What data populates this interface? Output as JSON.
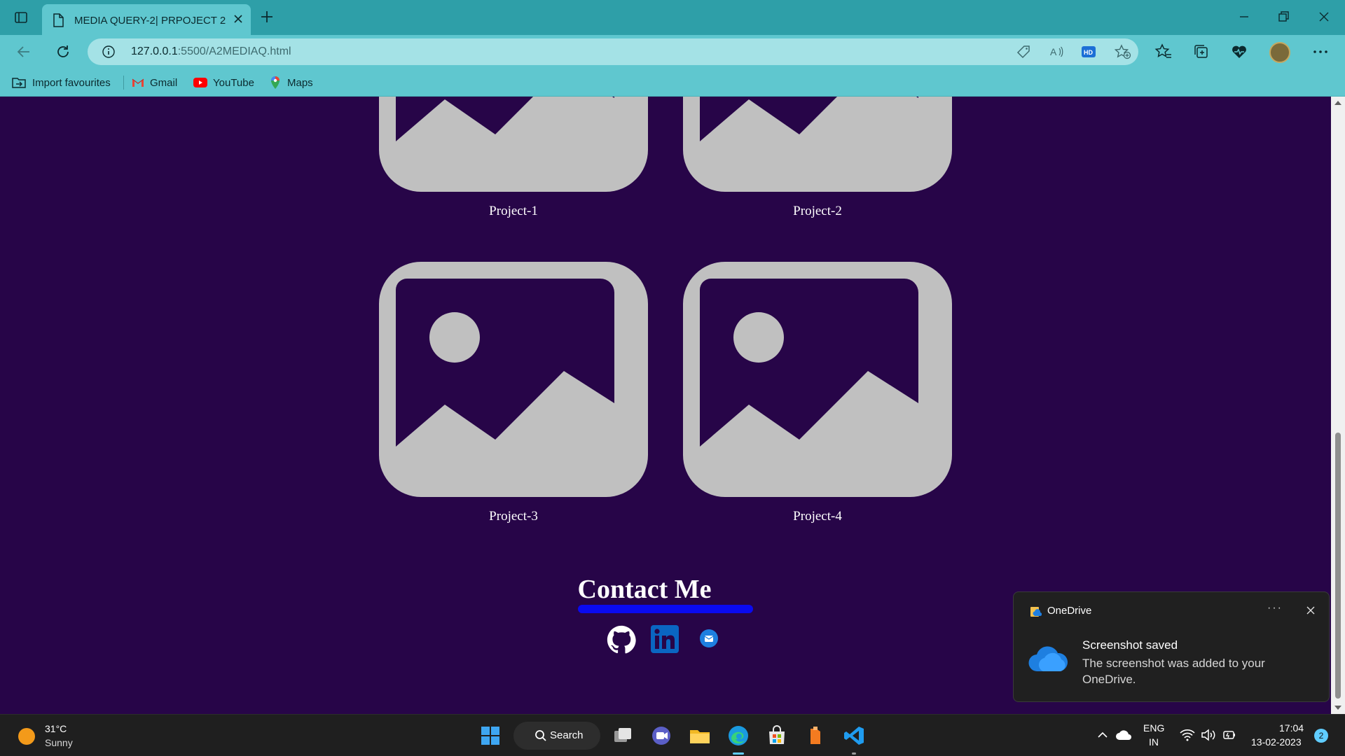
{
  "browser": {
    "tab_title": "MEDIA QUERY-2| PRPOJECT 2",
    "url_host": "127.0.0.1",
    "url_rest": ":5500/A2MEDIAQ.html",
    "favourites": [
      {
        "label": "Import favourites",
        "icon": "import-icon"
      },
      {
        "label": "Gmail",
        "icon": "gmail-icon"
      },
      {
        "label": "YouTube",
        "icon": "youtube-icon"
      },
      {
        "label": "Maps",
        "icon": "maps-icon"
      }
    ]
  },
  "page": {
    "background": "#270548",
    "placeholder_color": "#c0c0c0",
    "projects": [
      {
        "caption": "Project-1"
      },
      {
        "caption": "Project-2"
      },
      {
        "caption": "Project-3"
      },
      {
        "caption": "Project-4"
      }
    ],
    "contact": {
      "title": "Contact Me",
      "underline_color": "#0a0af0",
      "links": [
        {
          "icon": "github-icon"
        },
        {
          "icon": "linkedin-icon"
        },
        {
          "icon": "email-icon"
        }
      ]
    }
  },
  "notification": {
    "app": "OneDrive",
    "more": "···",
    "heading": "Screenshot saved",
    "body": "The screenshot was added to your OneDrive."
  },
  "taskbar": {
    "weather_temp": "31°C",
    "weather_condition": "Sunny",
    "search_label": "Search",
    "lang_line1": "ENG",
    "lang_line2": "IN",
    "time": "17:04",
    "date": "13-02-2023",
    "notification_count": "2"
  }
}
